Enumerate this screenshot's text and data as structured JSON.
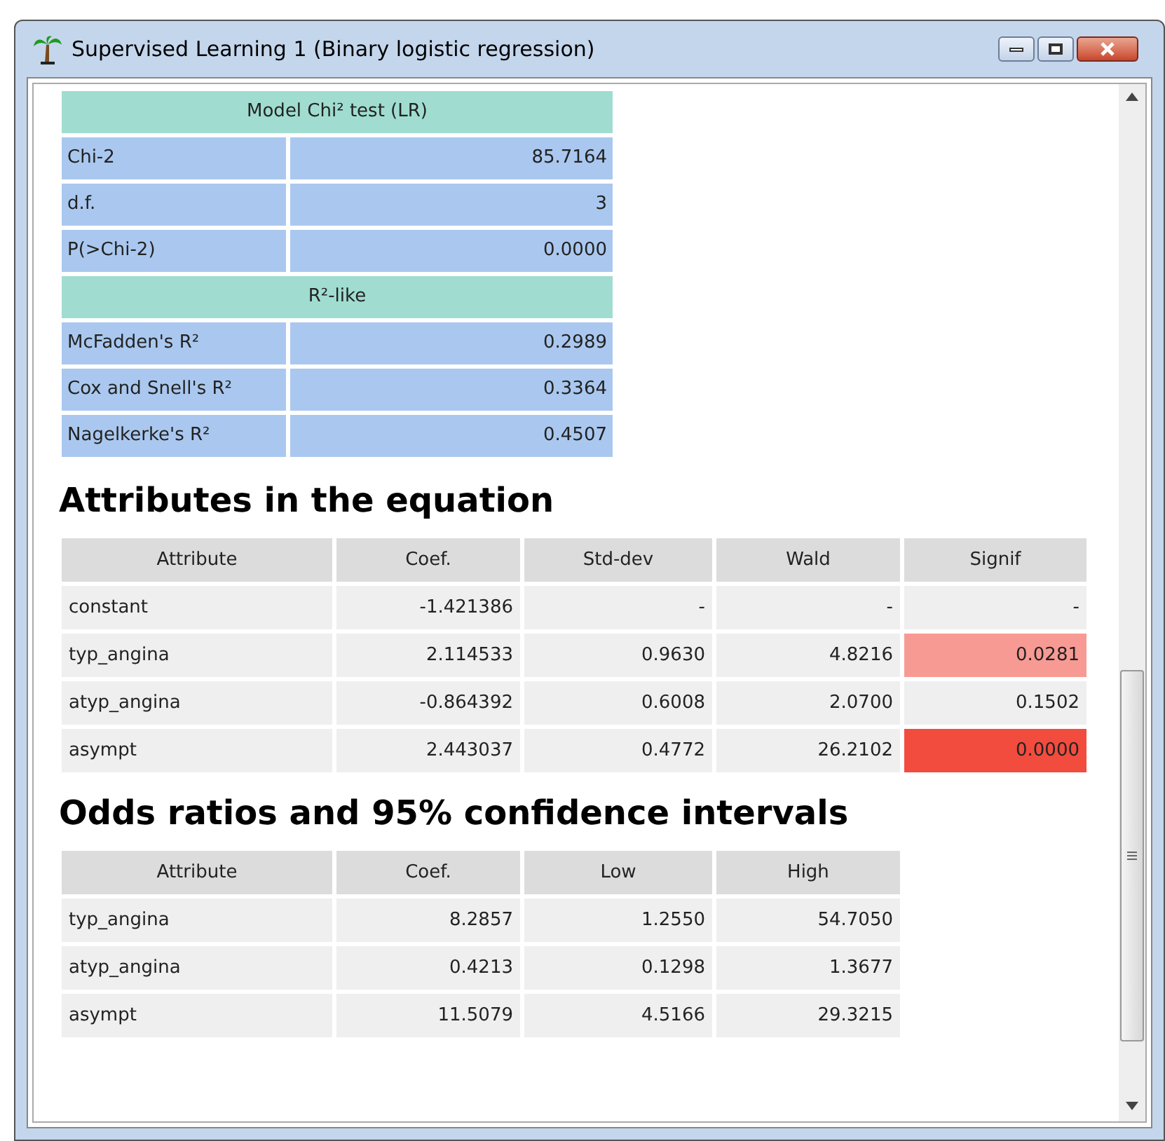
{
  "window": {
    "title": "Supervised Learning 1 (Binary logistic regression)"
  },
  "fit_table": {
    "sections": [
      {
        "header": "Model Chi² test (LR)",
        "rows": [
          [
            "Chi-2",
            "85.7164"
          ],
          [
            "d.f.",
            "3"
          ],
          [
            "P(>Chi-2)",
            "0.0000"
          ]
        ]
      },
      {
        "header": "R²-like",
        "rows": [
          [
            "McFadden's R²",
            "0.2989"
          ],
          [
            "Cox and Snell's R²",
            "0.3364"
          ],
          [
            "Nagelkerke's R²",
            "0.4507"
          ]
        ]
      }
    ]
  },
  "equation": {
    "heading": "Attributes in the equation",
    "columns": [
      "Attribute",
      "Coef.",
      "Std-dev",
      "Wald",
      "Signif"
    ],
    "rows": [
      {
        "cells": [
          "constant",
          "-1.421386",
          "-",
          "-",
          "-"
        ]
      },
      {
        "cells": [
          "typ_angina",
          "2.114533",
          "0.9630",
          "4.8216",
          "0.0281"
        ],
        "color": "#f89a94"
      },
      {
        "cells": [
          "atyp_angina",
          "-0.864392",
          "0.6008",
          "2.0700",
          "0.1502"
        ]
      },
      {
        "cells": [
          "asympt",
          "2.443037",
          "0.4772",
          "26.2102",
          "0.0000"
        ],
        "color": "#f24c3e"
      }
    ]
  },
  "odds": {
    "heading": "Odds ratios and 95% confidence intervals",
    "columns": [
      "Attribute",
      "Coef.",
      "Low",
      "High"
    ],
    "rows": [
      {
        "cells": [
          "typ_angina",
          "8.2857",
          "1.2550",
          "54.7050"
        ]
      },
      {
        "cells": [
          "atyp_angina",
          "0.4213",
          "0.1298",
          "1.3677"
        ]
      },
      {
        "cells": [
          "asympt",
          "11.5079",
          "4.5166",
          "29.3215"
        ]
      }
    ]
  }
}
